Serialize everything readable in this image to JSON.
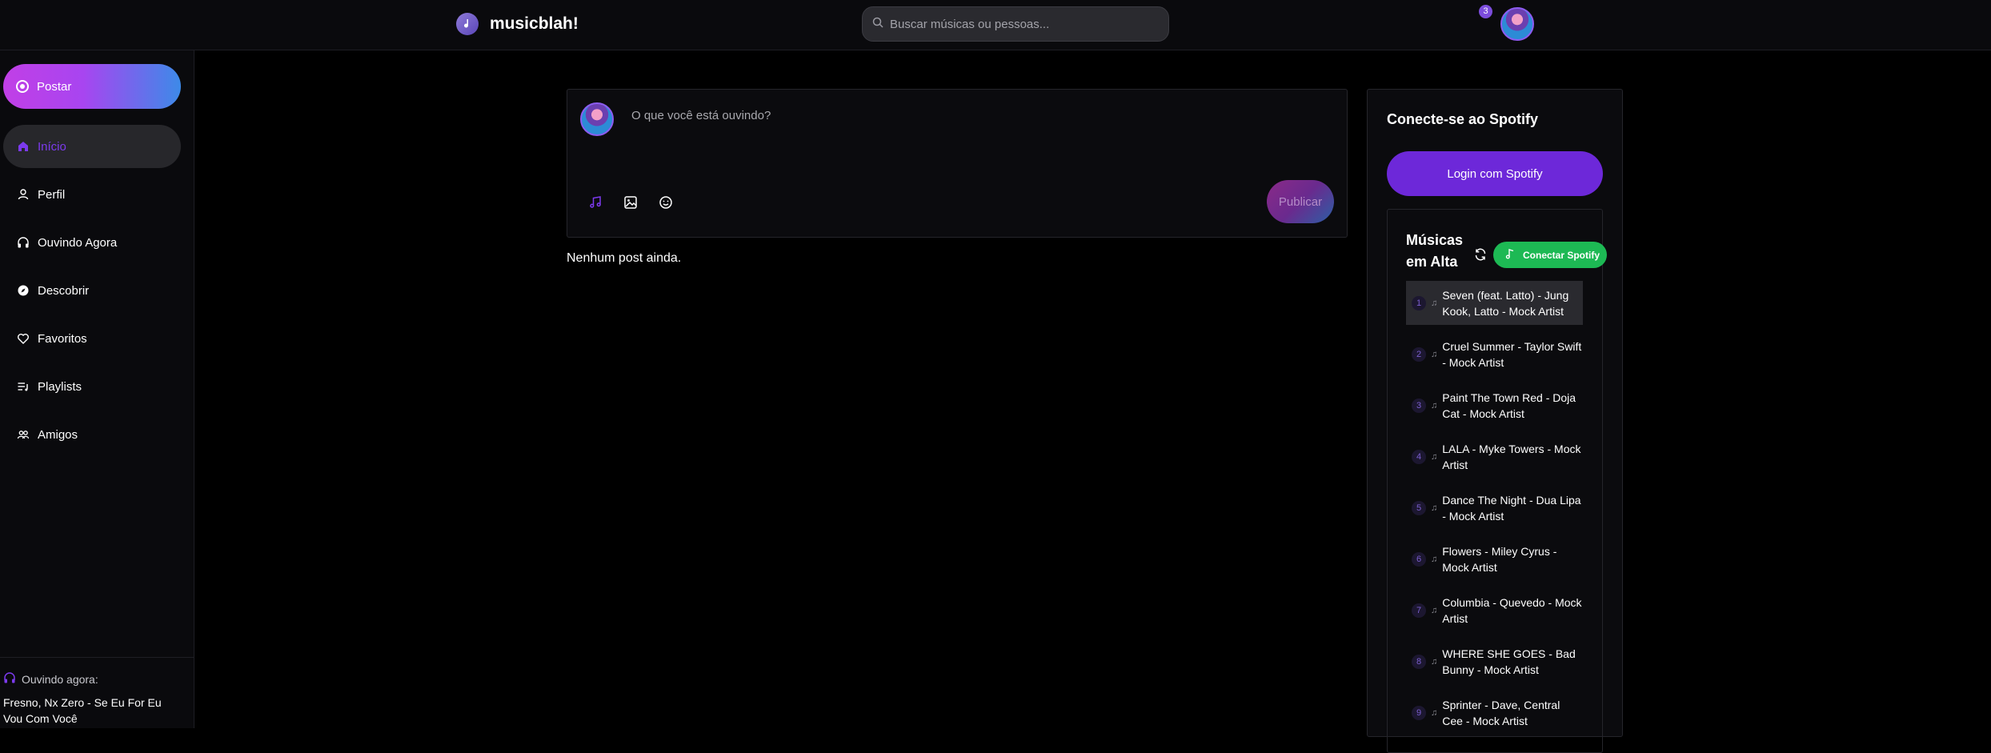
{
  "header": {
    "app_name": "musicblah!",
    "search_placeholder": "Buscar músicas ou pessoas...",
    "notification_count": "3"
  },
  "sidebar": {
    "post_label": "Postar",
    "items": [
      {
        "label": "Início",
        "icon": "home-icon",
        "active": true
      },
      {
        "label": "Perfil",
        "icon": "user-icon"
      },
      {
        "label": "Ouvindo Agora",
        "icon": "headphones-icon"
      },
      {
        "label": "Descobrir",
        "icon": "compass-icon"
      },
      {
        "label": "Favoritos",
        "icon": "heart-icon"
      },
      {
        "label": "Playlists",
        "icon": "playlist-icon"
      },
      {
        "label": "Amigos",
        "icon": "friends-icon"
      }
    ],
    "now_playing_label": "Ouvindo agora:",
    "now_playing_track": "Fresno, Nx Zero - Se Eu For Eu Vou Com Você"
  },
  "composer": {
    "placeholder": "O que você está ouvindo?",
    "publish_label": "Publicar"
  },
  "feed": {
    "empty_message": "Nenhum post ainda."
  },
  "spotify": {
    "title": "Conecte-se ao Spotify",
    "login_label": "Login com Spotify",
    "trending_title": "Músicas em Alta",
    "connect_label": "Conectar Spotify",
    "tracks": [
      {
        "n": "1",
        "title": "Seven (feat. Latto) - Jung Kook, Latto - Mock Artist"
      },
      {
        "n": "2",
        "title": "Cruel Summer - Taylor Swift - Mock Artist"
      },
      {
        "n": "3",
        "title": "Paint The Town Red - Doja Cat - Mock Artist"
      },
      {
        "n": "4",
        "title": "LALA - Myke Towers - Mock Artist"
      },
      {
        "n": "5",
        "title": "Dance The Night - Dua Lipa - Mock Artist"
      },
      {
        "n": "6",
        "title": "Flowers - Miley Cyrus - Mock Artist"
      },
      {
        "n": "7",
        "title": "Columbia - Quevedo - Mock Artist"
      },
      {
        "n": "8",
        "title": "WHERE SHE GOES - Bad Bunny - Mock Artist"
      },
      {
        "n": "9",
        "title": "Sprinter - Dave, Central Cee - Mock Artist"
      }
    ]
  },
  "colors": {
    "accent": "#7c3aed",
    "spotify_green": "#1db954"
  }
}
